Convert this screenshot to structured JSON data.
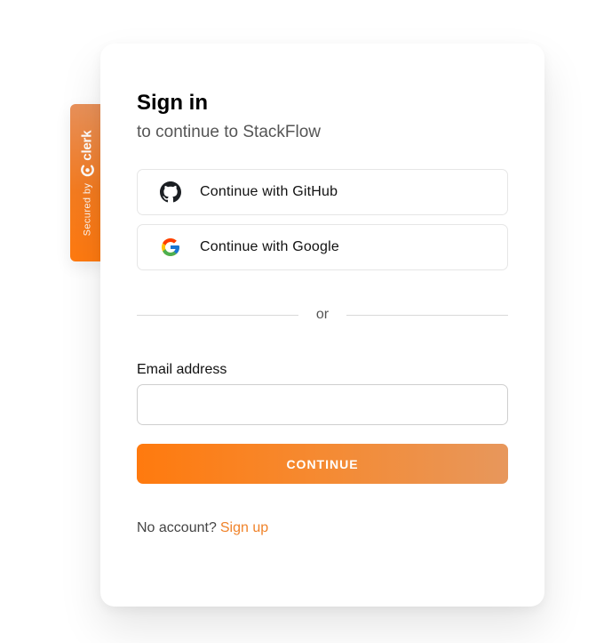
{
  "badge": {
    "secured_text": "Secured by",
    "brand": "clerk"
  },
  "card": {
    "title": "Sign in",
    "subtitle": "to continue to StackFlow"
  },
  "social": [
    {
      "label": "Continue with GitHub",
      "icon": "github-icon"
    },
    {
      "label": "Continue with Google",
      "icon": "google-icon"
    }
  ],
  "divider": {
    "text": "or"
  },
  "email": {
    "label": "Email address",
    "value": "",
    "placeholder": ""
  },
  "continue_button": {
    "label": "CONTINUE"
  },
  "footer": {
    "prompt": "No account?",
    "link": "Sign up"
  },
  "colors": {
    "accent": "#f47b20",
    "link": "#f0832a"
  }
}
